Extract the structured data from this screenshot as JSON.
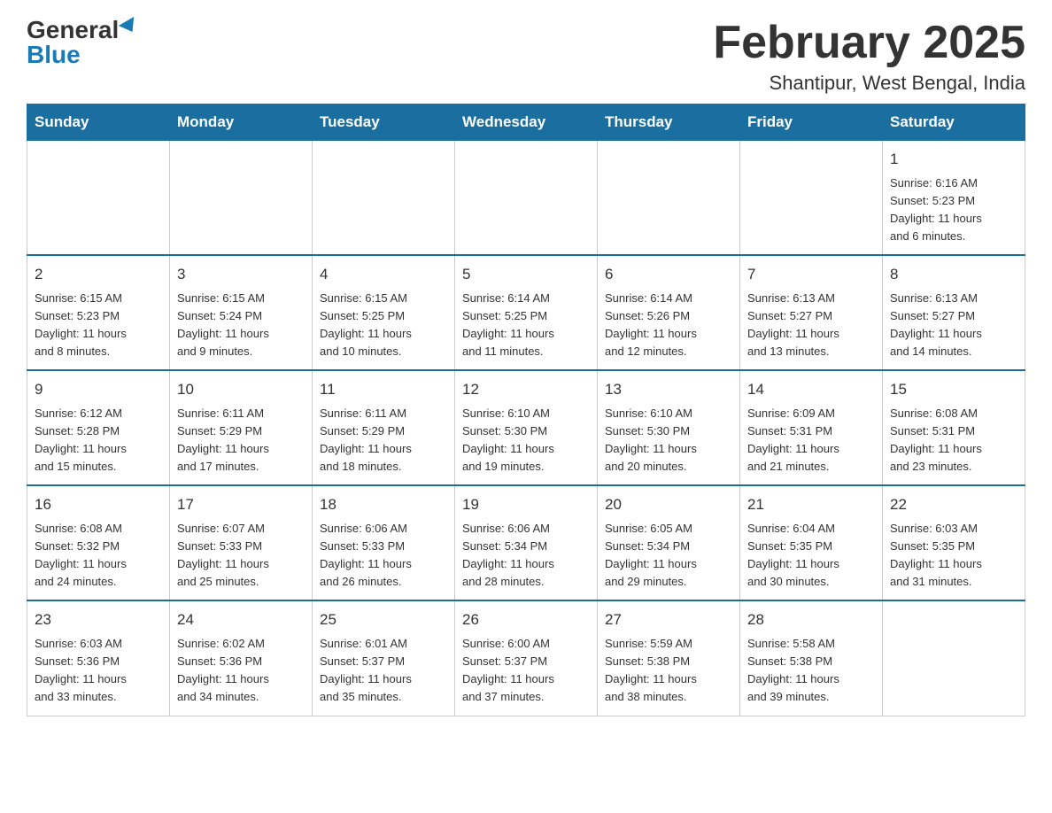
{
  "header": {
    "logo_general": "General",
    "logo_blue": "Blue",
    "month_title": "February 2025",
    "location": "Shantipur, West Bengal, India"
  },
  "weekdays": [
    "Sunday",
    "Monday",
    "Tuesday",
    "Wednesday",
    "Thursday",
    "Friday",
    "Saturday"
  ],
  "weeks": [
    [
      {
        "day": "",
        "info": ""
      },
      {
        "day": "",
        "info": ""
      },
      {
        "day": "",
        "info": ""
      },
      {
        "day": "",
        "info": ""
      },
      {
        "day": "",
        "info": ""
      },
      {
        "day": "",
        "info": ""
      },
      {
        "day": "1",
        "info": "Sunrise: 6:16 AM\nSunset: 5:23 PM\nDaylight: 11 hours\nand 6 minutes."
      }
    ],
    [
      {
        "day": "2",
        "info": "Sunrise: 6:15 AM\nSunset: 5:23 PM\nDaylight: 11 hours\nand 8 minutes."
      },
      {
        "day": "3",
        "info": "Sunrise: 6:15 AM\nSunset: 5:24 PM\nDaylight: 11 hours\nand 9 minutes."
      },
      {
        "day": "4",
        "info": "Sunrise: 6:15 AM\nSunset: 5:25 PM\nDaylight: 11 hours\nand 10 minutes."
      },
      {
        "day": "5",
        "info": "Sunrise: 6:14 AM\nSunset: 5:25 PM\nDaylight: 11 hours\nand 11 minutes."
      },
      {
        "day": "6",
        "info": "Sunrise: 6:14 AM\nSunset: 5:26 PM\nDaylight: 11 hours\nand 12 minutes."
      },
      {
        "day": "7",
        "info": "Sunrise: 6:13 AM\nSunset: 5:27 PM\nDaylight: 11 hours\nand 13 minutes."
      },
      {
        "day": "8",
        "info": "Sunrise: 6:13 AM\nSunset: 5:27 PM\nDaylight: 11 hours\nand 14 minutes."
      }
    ],
    [
      {
        "day": "9",
        "info": "Sunrise: 6:12 AM\nSunset: 5:28 PM\nDaylight: 11 hours\nand 15 minutes."
      },
      {
        "day": "10",
        "info": "Sunrise: 6:11 AM\nSunset: 5:29 PM\nDaylight: 11 hours\nand 17 minutes."
      },
      {
        "day": "11",
        "info": "Sunrise: 6:11 AM\nSunset: 5:29 PM\nDaylight: 11 hours\nand 18 minutes."
      },
      {
        "day": "12",
        "info": "Sunrise: 6:10 AM\nSunset: 5:30 PM\nDaylight: 11 hours\nand 19 minutes."
      },
      {
        "day": "13",
        "info": "Sunrise: 6:10 AM\nSunset: 5:30 PM\nDaylight: 11 hours\nand 20 minutes."
      },
      {
        "day": "14",
        "info": "Sunrise: 6:09 AM\nSunset: 5:31 PM\nDaylight: 11 hours\nand 21 minutes."
      },
      {
        "day": "15",
        "info": "Sunrise: 6:08 AM\nSunset: 5:31 PM\nDaylight: 11 hours\nand 23 minutes."
      }
    ],
    [
      {
        "day": "16",
        "info": "Sunrise: 6:08 AM\nSunset: 5:32 PM\nDaylight: 11 hours\nand 24 minutes."
      },
      {
        "day": "17",
        "info": "Sunrise: 6:07 AM\nSunset: 5:33 PM\nDaylight: 11 hours\nand 25 minutes."
      },
      {
        "day": "18",
        "info": "Sunrise: 6:06 AM\nSunset: 5:33 PM\nDaylight: 11 hours\nand 26 minutes."
      },
      {
        "day": "19",
        "info": "Sunrise: 6:06 AM\nSunset: 5:34 PM\nDaylight: 11 hours\nand 28 minutes."
      },
      {
        "day": "20",
        "info": "Sunrise: 6:05 AM\nSunset: 5:34 PM\nDaylight: 11 hours\nand 29 minutes."
      },
      {
        "day": "21",
        "info": "Sunrise: 6:04 AM\nSunset: 5:35 PM\nDaylight: 11 hours\nand 30 minutes."
      },
      {
        "day": "22",
        "info": "Sunrise: 6:03 AM\nSunset: 5:35 PM\nDaylight: 11 hours\nand 31 minutes."
      }
    ],
    [
      {
        "day": "23",
        "info": "Sunrise: 6:03 AM\nSunset: 5:36 PM\nDaylight: 11 hours\nand 33 minutes."
      },
      {
        "day": "24",
        "info": "Sunrise: 6:02 AM\nSunset: 5:36 PM\nDaylight: 11 hours\nand 34 minutes."
      },
      {
        "day": "25",
        "info": "Sunrise: 6:01 AM\nSunset: 5:37 PM\nDaylight: 11 hours\nand 35 minutes."
      },
      {
        "day": "26",
        "info": "Sunrise: 6:00 AM\nSunset: 5:37 PM\nDaylight: 11 hours\nand 37 minutes."
      },
      {
        "day": "27",
        "info": "Sunrise: 5:59 AM\nSunset: 5:38 PM\nDaylight: 11 hours\nand 38 minutes."
      },
      {
        "day": "28",
        "info": "Sunrise: 5:58 AM\nSunset: 5:38 PM\nDaylight: 11 hours\nand 39 minutes."
      },
      {
        "day": "",
        "info": ""
      }
    ]
  ]
}
